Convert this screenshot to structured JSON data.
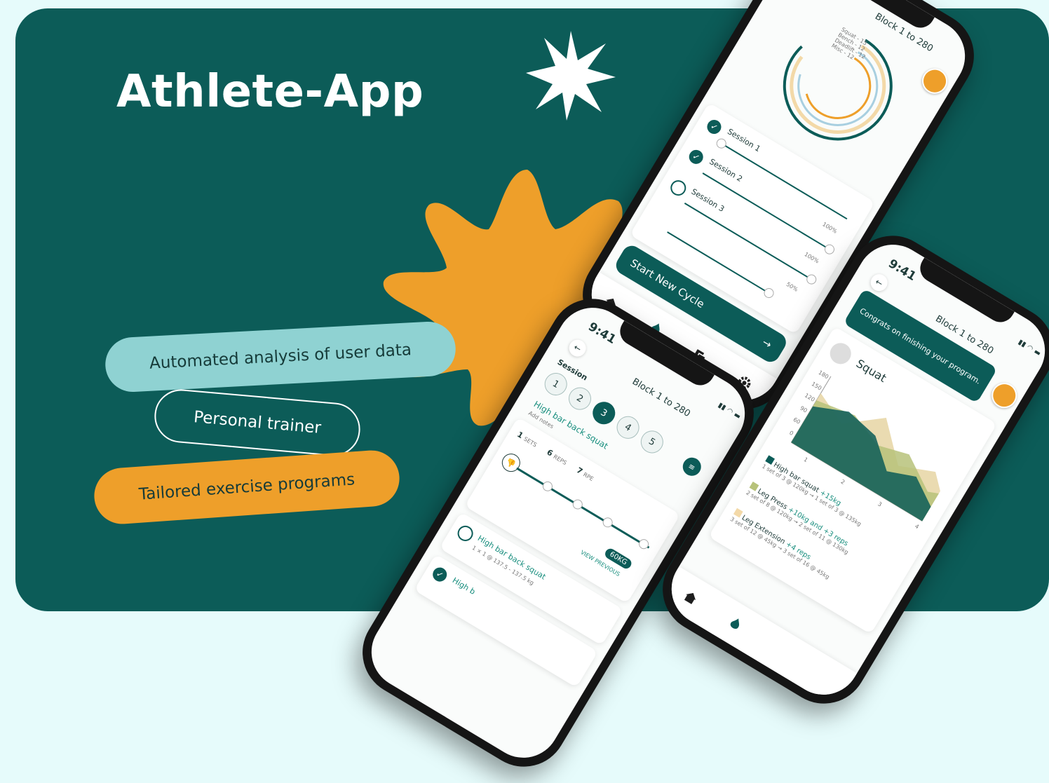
{
  "hero": {
    "title": "Athlete-App",
    "features": [
      "Automated analysis of user data",
      "Personal trainer",
      "Tailored exercise programs"
    ]
  },
  "colors": {
    "teal": "#0c5c58",
    "orange": "#ee9f2a",
    "mint": "#8fd2d2",
    "bg": "#e6fbfb"
  },
  "phone1": {
    "header": "Block 1 to 280",
    "ring_legend": [
      "Squat - 15",
      "Bench - 12",
      "Deadlift - 12",
      "Misc - 12"
    ],
    "sessions": [
      {
        "label": "Session 1",
        "status": "done",
        "pct": ""
      },
      {
        "label": "Session 2",
        "status": "done",
        "pct": "100%"
      },
      {
        "label": "Session 3",
        "status": "open",
        "pct": "100%"
      },
      {
        "label": "",
        "status": "",
        "pct": "50%"
      }
    ],
    "cta": "Start New Cycle",
    "cta_icon": "arrow-right-icon",
    "tabs": [
      "home-icon",
      "flame-icon",
      "cards-icon",
      "gear-icon"
    ]
  },
  "phone2": {
    "time": "9:41",
    "header": "Block 1 to 280",
    "session_label": "Session",
    "session_numbers": [
      "1",
      "2",
      "3",
      "4",
      "5"
    ],
    "active_session": "3",
    "exercise": "High bar back squat",
    "exercise_sub": "Add notes",
    "sets_value": "1",
    "sets_label": "SETS",
    "reps_value": "6",
    "reps_label": "REPS",
    "rpe_value": "7",
    "rpe_label": "RPE",
    "weight_badge": "60KG",
    "view_previous": "VIEW PREVIOUS",
    "next_exercise": "High bar back squat",
    "next_exercise_sub": "1 × 1 @ 137.5 - 137.5 kg",
    "next_exercise_2": "High b"
  },
  "phone3": {
    "time": "9:41",
    "header": "Block 1 to 280",
    "banner": "Congrats on finishing your program.",
    "exercise": "Squat",
    "chart_y_ticks": [
      "180",
      "150",
      "120",
      "90",
      "60",
      "0"
    ],
    "chart_x_ticks": [
      "1",
      "2",
      "3",
      "4"
    ],
    "rows": [
      {
        "name": "High bar squat",
        "gain": "+15kg",
        "from": "1 set of 3 @ 120kg",
        "to": "1 set of 3 @ 135kg",
        "color": "#0c5c58"
      },
      {
        "name": "Leg Press",
        "gain": "+10kg and +3 reps",
        "from": "2 set of 8 @ 120kg",
        "to": "2 set of 11 @ 130kg",
        "color": "#b7c27a"
      },
      {
        "name": "Leg Extension",
        "gain": "+4 reps",
        "from": "3 set of 12 @ 45kg",
        "to": "3 set of 16 @ 45kg",
        "color": "#f3d9a8"
      }
    ],
    "tabs": [
      "home-icon",
      "flame-icon"
    ]
  }
}
